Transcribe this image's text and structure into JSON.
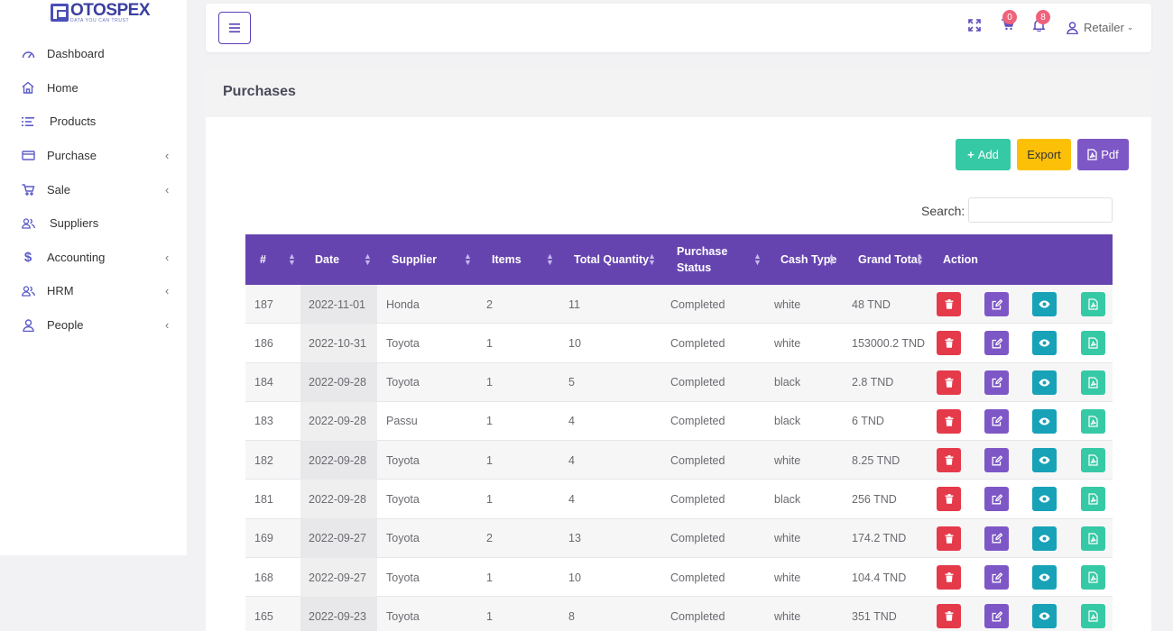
{
  "brand": {
    "name": "OTOSPEX",
    "tagline": "DATA YOU CAN TRUST"
  },
  "sidebar": {
    "items": [
      {
        "label": "Dashboard",
        "icon": "gauge-icon",
        "has_submenu": false
      },
      {
        "label": "Home",
        "icon": "home-icon",
        "has_submenu": false
      },
      {
        "label": "Products",
        "icon": "list-icon",
        "has_submenu": false
      },
      {
        "label": "Purchase",
        "icon": "credit-card-icon",
        "has_submenu": true
      },
      {
        "label": "Sale",
        "icon": "cart-icon",
        "has_submenu": true
      },
      {
        "label": "Suppliers",
        "icon": "users-icon",
        "has_submenu": false
      },
      {
        "label": "Accounting",
        "icon": "dollar-icon",
        "has_submenu": true
      },
      {
        "label": "HRM",
        "icon": "users-icon",
        "has_submenu": true
      },
      {
        "label": "People",
        "icon": "user-icon",
        "has_submenu": true
      }
    ],
    "chevron": "‹"
  },
  "topbar": {
    "cart_count": "0",
    "notification_count": "8",
    "user_label": "Retailer"
  },
  "page": {
    "title": "Purchases",
    "add_label": "Add",
    "export_label": "Export",
    "pdf_label": "Pdf",
    "search_label": "Search:",
    "search_value": ""
  },
  "table": {
    "columns": [
      "#",
      "Date",
      "Supplier",
      "Items",
      "Total Quantity",
      "Purchase Status",
      "Cash Type",
      "Grand Total",
      "Action"
    ],
    "rows": [
      {
        "id": "187",
        "date": "2022-11-01",
        "supplier": "Honda",
        "items": "2",
        "qty": "11",
        "status": "Completed",
        "cash": "white",
        "total": "48 TND"
      },
      {
        "id": "186",
        "date": "2022-10-31",
        "supplier": "Toyota",
        "items": "1",
        "qty": "10",
        "status": "Completed",
        "cash": "white",
        "total": "153000.2 TND"
      },
      {
        "id": "184",
        "date": "2022-09-28",
        "supplier": "Toyota",
        "items": "1",
        "qty": "5",
        "status": "Completed",
        "cash": "black",
        "total": "2.8 TND"
      },
      {
        "id": "183",
        "date": "2022-09-28",
        "supplier": "Passu",
        "items": "1",
        "qty": "4",
        "status": "Completed",
        "cash": "black",
        "total": "6 TND"
      },
      {
        "id": "182",
        "date": "2022-09-28",
        "supplier": "Toyota",
        "items": "1",
        "qty": "4",
        "status": "Completed",
        "cash": "white",
        "total": "8.25 TND"
      },
      {
        "id": "181",
        "date": "2022-09-28",
        "supplier": "Toyota",
        "items": "1",
        "qty": "4",
        "status": "Completed",
        "cash": "black",
        "total": "256 TND"
      },
      {
        "id": "169",
        "date": "2022-09-27",
        "supplier": "Toyota",
        "items": "2",
        "qty": "13",
        "status": "Completed",
        "cash": "white",
        "total": "174.2 TND"
      },
      {
        "id": "168",
        "date": "2022-09-27",
        "supplier": "Toyota",
        "items": "1",
        "qty": "10",
        "status": "Completed",
        "cash": "white",
        "total": "104.4 TND"
      },
      {
        "id": "165",
        "date": "2022-09-23",
        "supplier": "Toyota",
        "items": "1",
        "qty": "8",
        "status": "Completed",
        "cash": "white",
        "total": "351 TND"
      }
    ]
  },
  "colors": {
    "accent": "#6544b0",
    "add": "#36c9a5",
    "export": "#fcc008",
    "pdf": "#7e57c6",
    "delete": "#e53a4a",
    "view": "#17a2b8",
    "badge": "#f0627a"
  }
}
